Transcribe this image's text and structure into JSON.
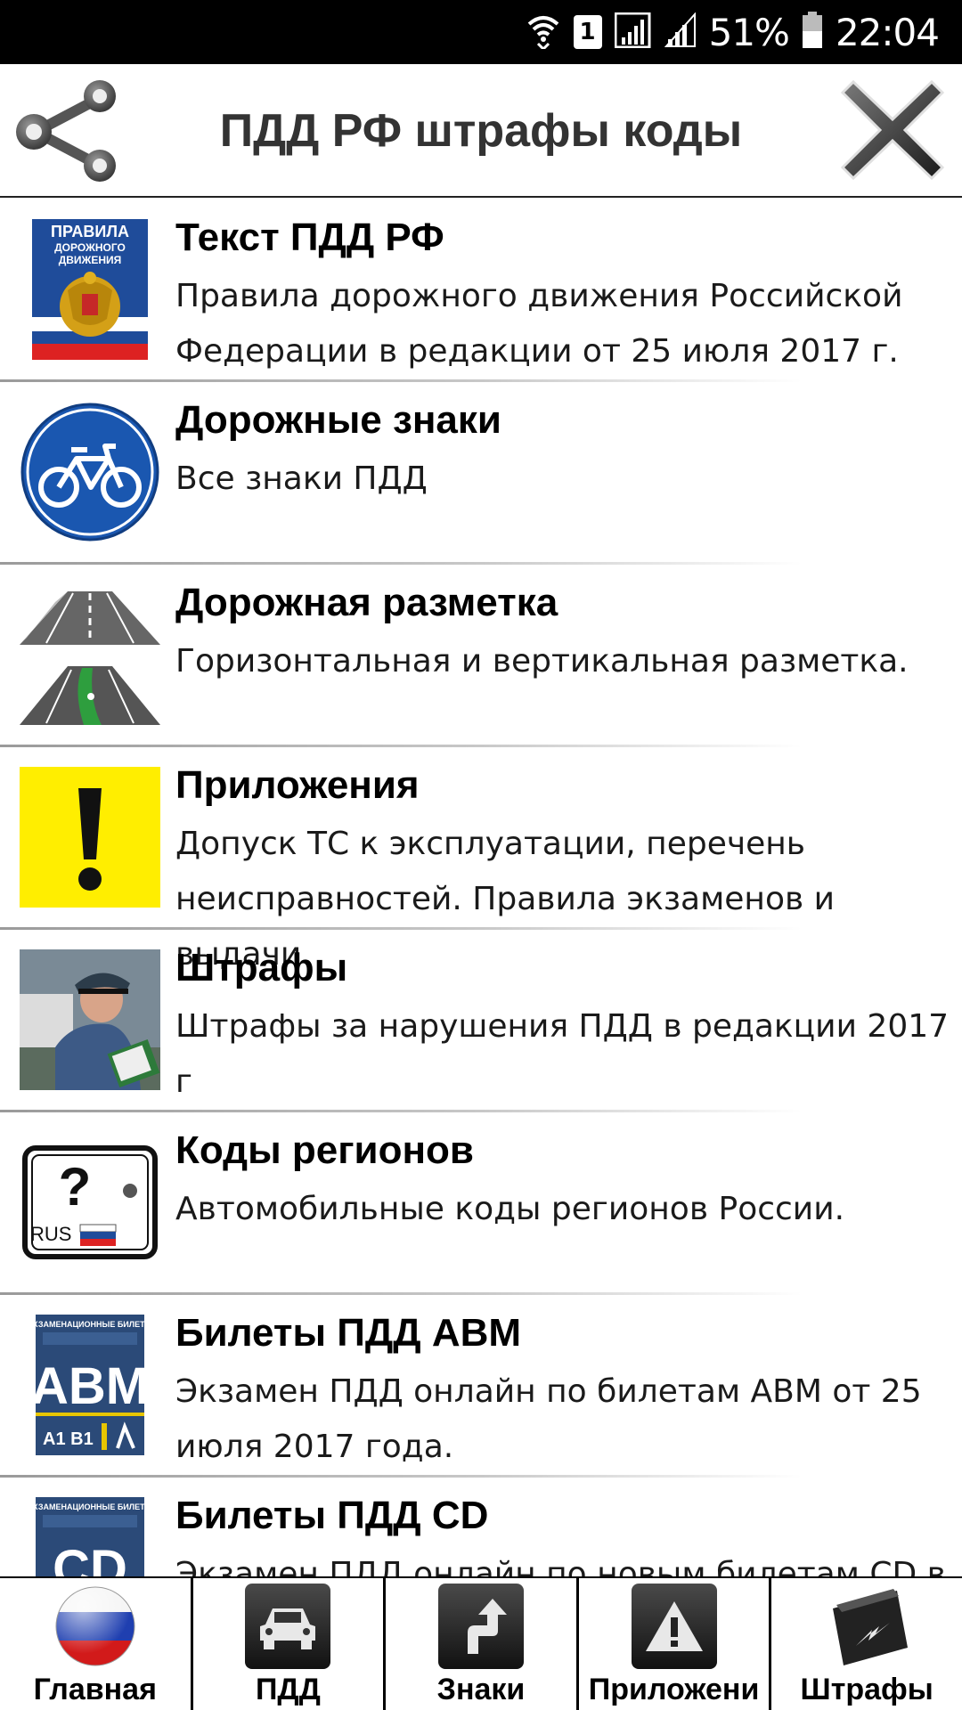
{
  "status_bar": {
    "sim_slot": "1",
    "battery": "51%",
    "time": "22:04"
  },
  "header": {
    "title": "ПДД РФ штрафы коды",
    "share_icon": "share-icon",
    "close_icon": "close-icon"
  },
  "items": [
    {
      "title": "Текст ПДД РФ",
      "description": "Правила дорожного движения Российской Федерации в редакции от 25 июля 2017 г.",
      "book_lines": [
        "ПРАВИЛА",
        "ДОРОЖНОГО",
        "ДВИЖЕНИЯ"
      ],
      "icon": "rules-book-icon"
    },
    {
      "title": "Дорожные знаки",
      "description": "Все знаки ПДД",
      "icon": "bicycle-sign-icon"
    },
    {
      "title": "Дорожная разметка",
      "description": "Горизонтальная и вертикальная разметка.",
      "icon": "road-marking-icon"
    },
    {
      "title": "Приложения",
      "description": "Допуск ТС к эксплуатации, перечень неисправностей. Правила экзаменов и выдачи",
      "icon": "warning-exclamation-icon"
    },
    {
      "title": "Штрафы",
      "description": "Штрафы за нарушения ПДД в редакции 2017 г",
      "icon": "traffic-police-photo"
    },
    {
      "title": "Коды регионов",
      "description": "Автомобильные коды регионов России.",
      "plate_text": "RUS",
      "plate_question": "?",
      "icon": "license-plate-icon"
    },
    {
      "title": "Билеты ПДД ABM",
      "description": "Экзамен ПДД онлайн  по билетам ABM от 25 июля 2017 года.",
      "booklet_header": "ЭКЗАМЕНАЦИОННЫЕ БИЛЕТЫ",
      "booklet_big": "ABM",
      "booklet_small": "A1 B1",
      "icon": "exam-tickets-abm-icon"
    },
    {
      "title": "Билеты ПДД CD",
      "description": "Экзамен ПДД онлайн  по новым билетам CD в",
      "booklet_header": "ЭКЗАМЕНАЦИОННЫЕ БИЛЕТЫ",
      "booklet_big": "CD",
      "icon": "exam-tickets-cd-icon"
    }
  ],
  "bottom_nav": [
    {
      "label": "Главная",
      "icon": "russia-flag-icon"
    },
    {
      "label": "ПДД",
      "icon": "car-icon"
    },
    {
      "label": "Знаки",
      "icon": "turn-arrow-icon"
    },
    {
      "label": "Приложени",
      "icon": "warning-triangle-icon"
    },
    {
      "label": "Штрафы",
      "icon": "fine-camera-icon"
    }
  ],
  "colors": {
    "status_bar_bg": "#000000",
    "sign_blue": "#1a57b0",
    "warning_yellow": "#ffee00",
    "booklet_blue": "#2b4a78"
  }
}
